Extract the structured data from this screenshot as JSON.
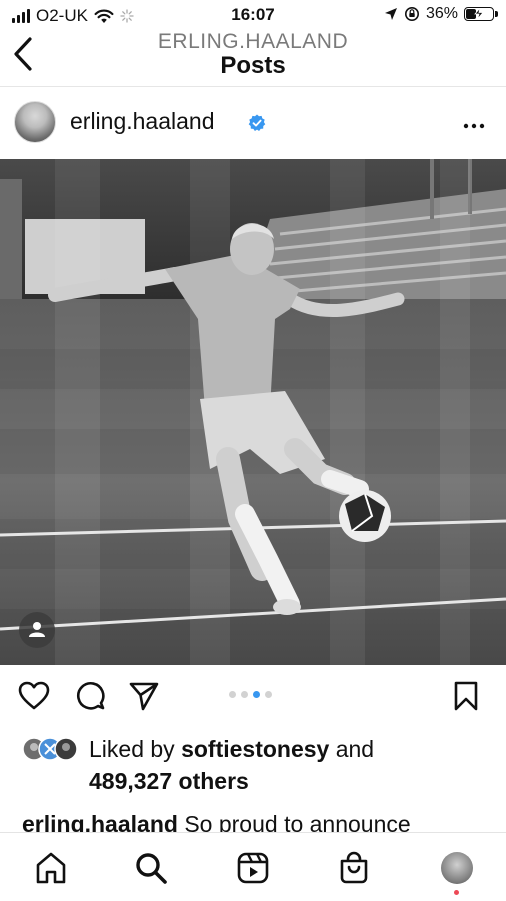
{
  "status_bar": {
    "carrier": "O2-UK",
    "time": "16:07",
    "battery": "36%"
  },
  "header": {
    "username": "ERLING.HAALAND",
    "title": "Posts"
  },
  "post": {
    "author": "erling.haaland",
    "verified": true,
    "carousel": {
      "total": 4,
      "active_index": 2
    },
    "likes": {
      "prefix": "Liked by ",
      "user": "softiestonesy",
      "conjunction": " and",
      "others": "489,327 others"
    },
    "caption": {
      "author": "erling.haaland",
      "text": " So proud to announce"
    }
  },
  "colors": {
    "accent_blue": "#3897f0",
    "notification_red": "#ed4956"
  },
  "icons": {
    "back": "chevron-left-icon",
    "more": "more-horizontal-icon",
    "like": "heart-icon",
    "comment": "comment-icon",
    "share": "send-icon",
    "save": "bookmark-icon",
    "tag": "user-tag-icon",
    "nav": [
      "home-icon",
      "search-icon",
      "reels-icon",
      "shop-icon",
      "profile-icon"
    ]
  }
}
